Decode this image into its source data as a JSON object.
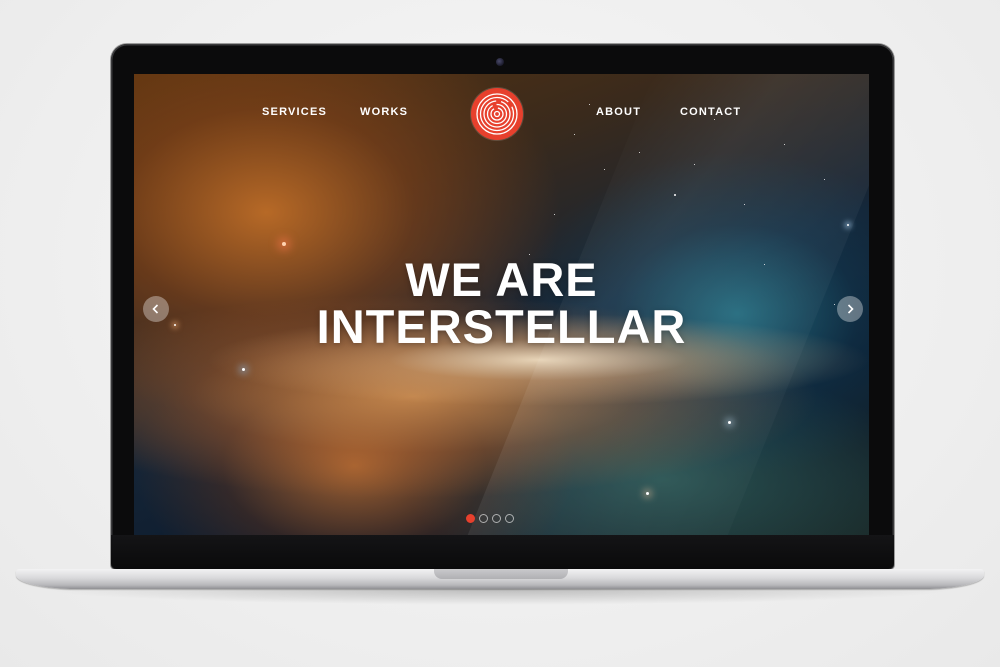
{
  "nav": {
    "left": [
      {
        "label": "SERVICES"
      },
      {
        "label": "WORKS"
      }
    ],
    "right": [
      {
        "label": "ABOUT"
      },
      {
        "label": "CONTACT"
      }
    ]
  },
  "logo": {
    "icon": "concentric-maze-icon",
    "color": "#e7402d"
  },
  "hero": {
    "line1": "WE ARE",
    "line2": "INTERSTELLAR"
  },
  "slider": {
    "prev_icon": "chevron-left-icon",
    "next_icon": "chevron-right-icon",
    "dot_count": 4,
    "active_index": 0,
    "accent": "#e7402d"
  }
}
